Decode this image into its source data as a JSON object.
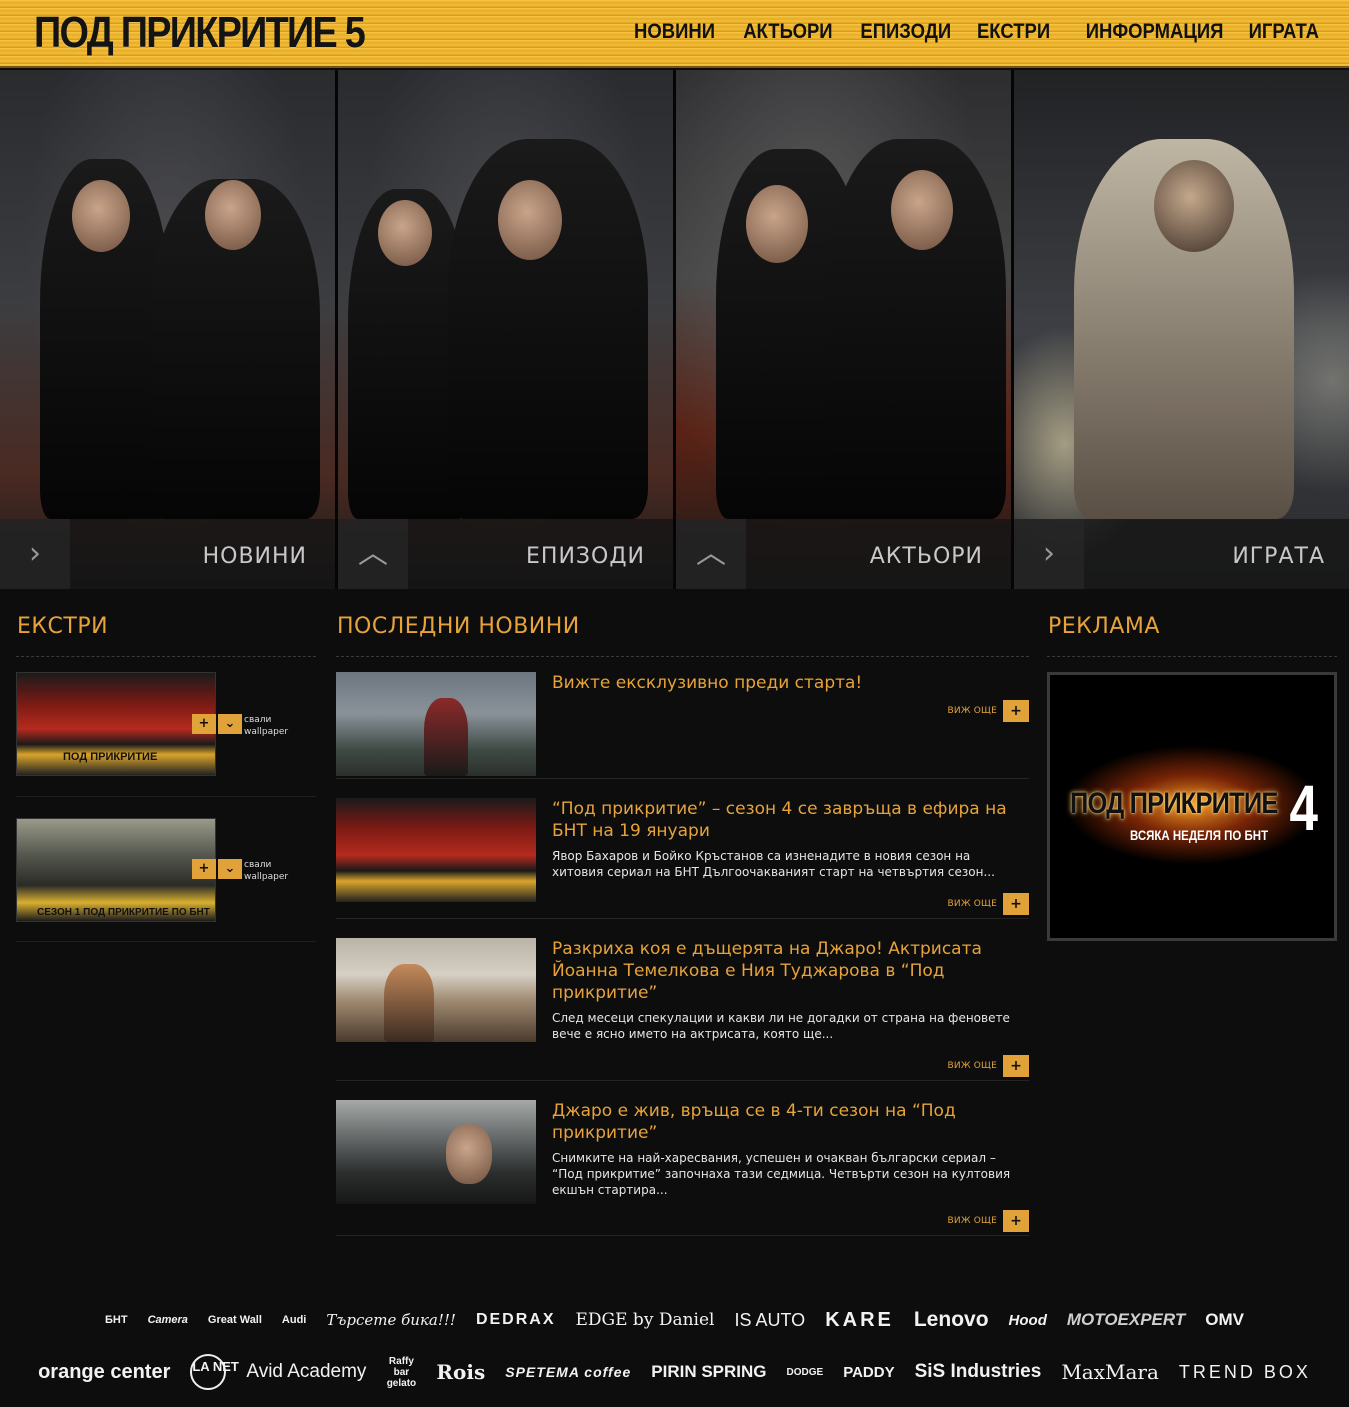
{
  "site": {
    "logo": "ПОД ПРИКРИТИЕ 5"
  },
  "nav": [
    "НОВИНИ",
    "АКТЬОРИ",
    "ЕПИЗОДИ",
    "ЕКСТРИ",
    "ИНФОРМАЦИЯ",
    "ИГРАТА"
  ],
  "hero": {
    "panels": [
      {
        "label": "НОВИНИ",
        "arrow": "›"
      },
      {
        "label": "ЕПИЗОДИ",
        "arrow": "︿"
      },
      {
        "label": "АКТЬОРИ",
        "arrow": "︿"
      },
      {
        "label": "ИГРАТА",
        "arrow": "›"
      }
    ]
  },
  "extras": {
    "title": "ЕКСТРИ",
    "items": [
      {
        "thumb_caption": "ПОД ПРИКРИТИЕ",
        "plus": "+",
        "down": "⌄",
        "label_line1": "свали",
        "label_line2": "wallpaper"
      },
      {
        "thumb_caption": "СЕЗОН 1 ПОД ПРИКРИТИЕ ПО БНТ",
        "plus": "+",
        "down": "⌄",
        "label_line1": "свали",
        "label_line2": "wallpaper"
      }
    ]
  },
  "news": {
    "title": "ПОСЛЕДНИ НОВИНИ",
    "more_label": "ВИЖ ОЩЕ",
    "more_icon": "+",
    "items": [
      {
        "title": "Вижте ексклузивно преди старта!",
        "excerpt": ""
      },
      {
        "title": "“Под прикритие” – сезон 4 се завръща в ефира на БНТ на 19 януари",
        "excerpt": "Явор Бахаров и Бойко Кръстанов са изненадите в новия сезон на хитовия сериал на БНТ Дългоочакваният старт на четвъртия сезон..."
      },
      {
        "title": "Разкриха коя е дъщерята на Джаро! Актрисата Йоанна Темелкова е Ния Туджарова в “Под прикритие”",
        "excerpt": "След месеци спекулации и какви ли не догадки от страна на феновете вече е ясно името на актрисата, която ще..."
      },
      {
        "title": "Джаро е жив, връща се в 4-ти сезон на “Под прикритие”",
        "excerpt": "Снимките на най-харесвания, успешен и очакван български сериал – “Под прикритие” започнаха тази седмица. Четвърти сезон на култовия екшън стартира..."
      }
    ]
  },
  "ad": {
    "title": "РЕКЛАМА",
    "banner_title": "ПОД ПРИКРИТИЕ",
    "banner_number": "4",
    "banner_sub": "ВСЯКА НЕДЕЛЯ ПО БНТ"
  },
  "sponsors": {
    "row1": [
      "БНТ",
      "Camera",
      "Great Wall",
      "Audi",
      "Търсете бика!!!",
      "DEDRAX",
      "EDGE by Daniel",
      "IS AUTO",
      "KARE",
      "Lenovo",
      "Hood",
      "MOTOEXPERT",
      "OMV"
    ],
    "row2": [
      "orange center",
      "LA NET",
      "Avid Academy",
      "Raffy bar gelato",
      "Rois",
      "SPETEMA coffee",
      "PIRIN SPRING",
      "DODGE",
      "PADDY",
      "SiS Industries",
      "MaxMara",
      "TREND BOX"
    ]
  }
}
